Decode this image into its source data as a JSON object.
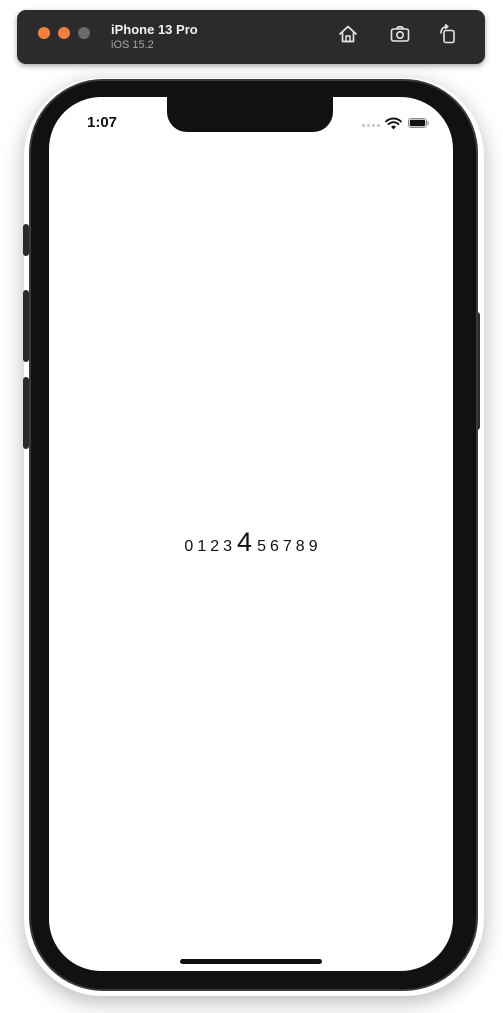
{
  "simulator": {
    "device_name": "iPhone 13 Pro",
    "os_version": "iOS 15.2",
    "buttons": [
      "home-icon",
      "screenshot-icon",
      "rotate-icon"
    ],
    "traffic_lights": [
      "#f0803b",
      "#f0803b",
      "#6b6b6e"
    ]
  },
  "status_bar": {
    "time": "1:07",
    "icons": [
      "signal-icon",
      "wifi-icon",
      "battery-icon"
    ]
  },
  "picker": {
    "digits": [
      "0",
      "1",
      "2",
      "3",
      "4",
      "5",
      "6",
      "7",
      "8",
      "9"
    ],
    "selected": "4"
  }
}
